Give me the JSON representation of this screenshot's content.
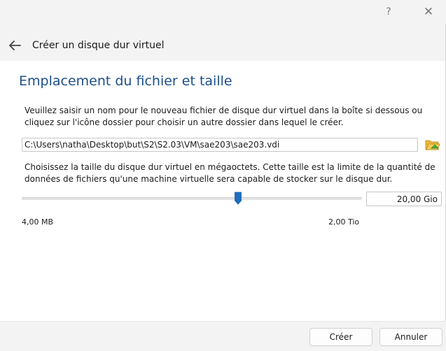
{
  "titlebar": {
    "help": "?",
    "close": "✕"
  },
  "header": {
    "title": "Créer un disque dur virtuel"
  },
  "page": {
    "title": "Emplacement du fichier et taille",
    "location_desc": "Veuillez saisir un nom pour le nouveau fichier de disque dur virtuel dans la boîte si dessous ou cliquez sur l'icône dossier pour choisir un autre dossier dans lequel le créer.",
    "file_path": "C:\\Users\\natha\\Desktop\\but\\S2\\S2.03\\VM\\sae203\\sae203.vdi",
    "size_desc": "Choisissez la taille du disque dur virtuel en mégaoctets. Cette taille est la limite de la quantité de données de fichiers qu'une machine virtuelle sera capable de stocker sur le disque dur.",
    "size_value": "20,00 Gio",
    "slider_fraction": 0.635,
    "range_min": "4,00 MB",
    "range_max": "2,00 Tio"
  },
  "footer": {
    "create": "Créer",
    "cancel": "Annuler"
  },
  "colors": {
    "title_blue": "#1c4f8c",
    "slider_handle": "#1f6fc4",
    "folder_yellow": "#e8b73a",
    "folder_green": "#4caf3a"
  },
  "icons": {
    "back": "back-arrow-icon",
    "folder": "folder-open-icon",
    "help": "help-icon",
    "close": "close-icon"
  }
}
